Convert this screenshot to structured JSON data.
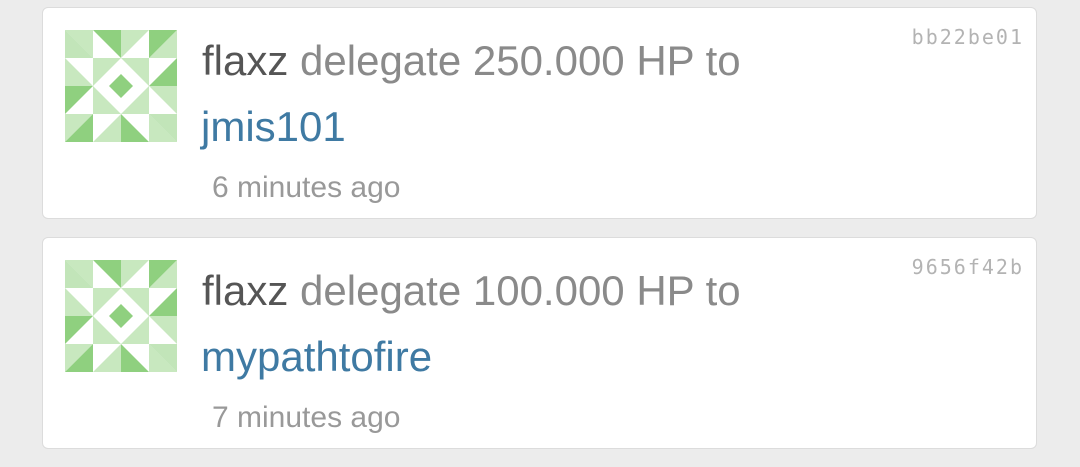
{
  "feed": [
    {
      "hash": "bb22be01",
      "user": "flaxz",
      "action": "delegate 250.000 HP to",
      "recipient": "jmis101",
      "time": "6 minutes ago",
      "avatar_icon": "identicon-green"
    },
    {
      "hash": "9656f42b",
      "user": "flaxz",
      "action": "delegate 100.000 HP to",
      "recipient": "mypathtofire",
      "time": "7 minutes ago",
      "avatar_icon": "identicon-green"
    }
  ],
  "colors": {
    "background": "#ececec",
    "card": "#ffffff",
    "link": "#3f7aa3",
    "identicon_light": "#c8e8bf",
    "identicon_dark": "#8fd07f"
  }
}
